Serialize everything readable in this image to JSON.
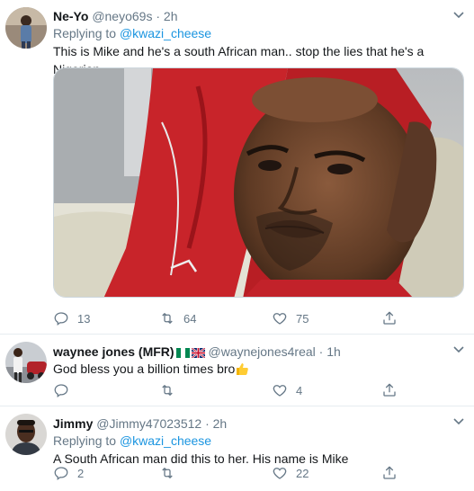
{
  "tweets": [
    {
      "name": "Ne-Yo",
      "handle": "@neyo69s",
      "dot": "·",
      "time": "2h",
      "replying_prefix": "Replying to ",
      "replying_to": "@kwazi_cheese",
      "text": "This is Mike and he's a south African man.. stop the lies that he's a Nigerian.",
      "replies": "13",
      "retweets": "64",
      "likes": "75"
    },
    {
      "name": "waynee jones (MFR)",
      "handle": "@waynejones4real",
      "dot": "·",
      "time": "1h",
      "text": "God bless you a billion times bro",
      "replies": "",
      "retweets": "",
      "likes": "4"
    },
    {
      "name": "Jimmy",
      "handle": "@Jimmy47023512",
      "dot": "·",
      "time": "2h",
      "replying_prefix": "Replying to ",
      "replying_to": "@kwazi_cheese",
      "text": "A South African man did this to her. His name is Mike",
      "replies": "2",
      "retweets": "",
      "likes": "22"
    }
  ],
  "icons": {
    "reply": "reply-icon",
    "retweet": "retweet-icon",
    "like": "heart-icon",
    "share": "share-icon",
    "more": "chevron-down-icon"
  },
  "colors": {
    "link": "#1b95e0",
    "secondary": "#657786",
    "text": "#14171a",
    "divider": "#e6ecf0"
  }
}
